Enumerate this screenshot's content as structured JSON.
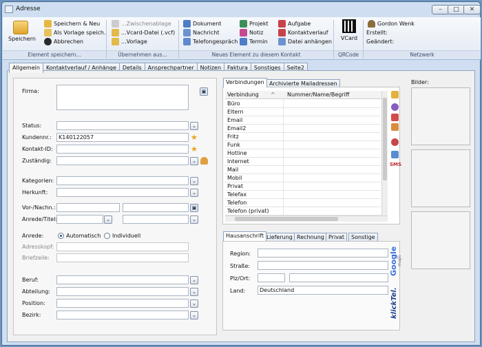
{
  "window": {
    "title": "Adresse",
    "min": "–",
    "max": "□",
    "close": "✕"
  },
  "ribbon": {
    "save": {
      "big_label": "Speichern",
      "items": [
        "Speichern & Neu",
        "Als Vorlage speich.",
        "Abbrechen"
      ],
      "group": "Element speichern..."
    },
    "take": {
      "items": [
        "...Zwischenablage",
        "...Vcard-Datei (.vcf)",
        "...Vorlage"
      ],
      "group": "Übernehmen aus..."
    },
    "newel": {
      "col1": [
        "Dokument",
        "Nachricht",
        "Telefongespräch"
      ],
      "col2": [
        "Projekt",
        "Notiz",
        "Termin"
      ],
      "col3": [
        "Aufgabe",
        "Kontaktverlauf",
        "Datei anhängen"
      ],
      "group": "Neues Element zu diesem Kontakt"
    },
    "qr": {
      "label": "VCard",
      "group": "QRCode"
    },
    "net": {
      "user": "Gordon Wenk",
      "created": "Erstellt:",
      "changed": "Geändert:",
      "group": "Netzwerk"
    }
  },
  "tabs": [
    "Allgemein",
    "Kontaktverlauf / Anhänge",
    "Details",
    "Ansprechpartner",
    "Notizen",
    "Faktura",
    "Sonstiges",
    "Seite2"
  ],
  "form": {
    "firma": "Firma:",
    "status": "Status:",
    "kundennr": "Kundennr.:",
    "kundennr_value": "K140122057",
    "kontakt_id": "Kontakt-ID:",
    "zustaendig": "Zuständig:",
    "kategorien": "Kategorien:",
    "herkunft": "Herkunft:",
    "vorname": "Vor-/Nachn.:",
    "anrede_titel": "Anrede/Titel:",
    "anrede": "Anrede:",
    "auto": "Automatisch",
    "indiv": "Individuell",
    "adresskopf": "Adresskopf:",
    "briefzeile": "Briefzeile:",
    "beruf": "Beruf:",
    "abteilung": "Abteilung:",
    "position": "Position:",
    "bezirk": "Bezirk:"
  },
  "connections": {
    "tabs": [
      "Verbindungen",
      "Archivierte Mailadressen"
    ],
    "col1": "Verbindung",
    "col2": "Nummer/Name/Begriff",
    "rows": [
      "Büro",
      "Eltern",
      "Email",
      "Email2",
      "Fritz",
      "Funk",
      "Hotline",
      "Internet",
      "Mail",
      "Mobil",
      "Privat",
      "Telefax",
      "Telefon",
      "Telefon (privat)"
    ]
  },
  "address": {
    "tabs": [
      "Hausanschrift",
      "Lieferung",
      "Rechnung",
      "Privat",
      "Sonstige"
    ],
    "region": "Region:",
    "strasse": "Straße:",
    "plzort": "Plz/Ort:",
    "land": "Land:",
    "land_value": "Deutschland",
    "google": "Google",
    "maps": "maps",
    "klicktel": "klickTel."
  },
  "bilder": "Bilder:",
  "sms": "SMS"
}
